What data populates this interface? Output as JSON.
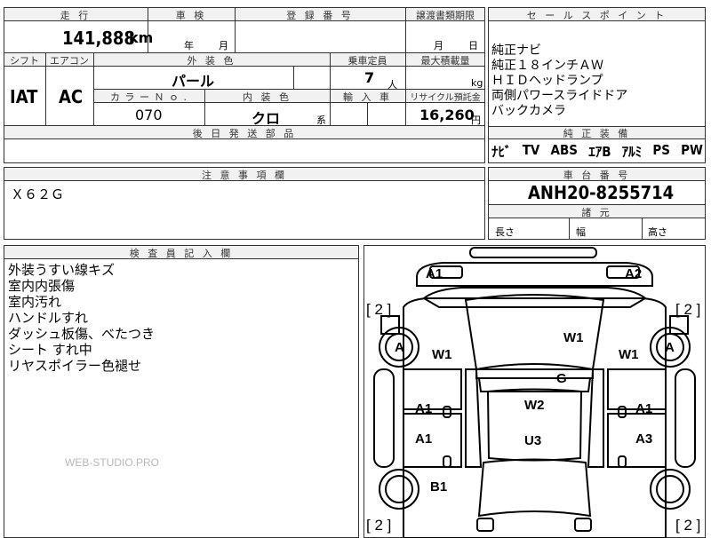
{
  "top_table": {
    "mileage_label": "走 行",
    "mileage_value": "141,888",
    "mileage_unit": "km",
    "shaken_label": "車 検",
    "shaken_year": "年",
    "shaken_month": "月",
    "registration_label": "登 録 番 号",
    "transfer_label": "譲渡書類期限",
    "transfer_month": "月",
    "transfer_day": "日",
    "shift_label": "シフト",
    "shift_value": "IAT",
    "ac_label": "エアコン",
    "ac_value": "AC",
    "exterior_color_label": "外 装 色",
    "exterior_color_value": "パール",
    "capacity_label": "乗車定員",
    "capacity_value": "7",
    "capacity_unit": "人",
    "max_load_label": "最大積載量",
    "max_load_unit": "kg",
    "color_no_label": "カ ラ ー Ｎ ｏ .",
    "color_no_value": "070",
    "interior_color_label": "内 装 色",
    "interior_color_value": "クロ",
    "interior_color_suffix": "系",
    "import_label": "輸 入 車",
    "recycle_label": "リサイクル預託金",
    "recycle_value": "16,260",
    "recycle_unit": "円",
    "later_parts_label": "後 日 発 送 部 品"
  },
  "sales_points": {
    "label": "セ ー ル ス ポ イ ン ト",
    "lines": [
      "純正ナビ",
      "純正１８インチＡＷ",
      "ＨＩＤヘッドランプ",
      "両側パワースライドドア",
      "バックカメラ"
    ]
  },
  "genuine_equipment": {
    "label": "純 正 装 備",
    "items": [
      "ﾅﾋﾞ",
      "TV",
      "ABS",
      "ｴｱB",
      "ｱﾙﾐ",
      "PS",
      "PW"
    ]
  },
  "caution": {
    "label": "注 意 事 項 欄",
    "text": "Ｘ６２Ｇ"
  },
  "chassis": {
    "label": "車 台 番 号",
    "value": "ANH20-8255714",
    "dimensions_label": "諸 元",
    "length_label": "長さ",
    "width_label": "幅",
    "height_label": "高さ"
  },
  "inspector": {
    "label": "検 査 員 記 入 欄",
    "lines": [
      "外装うすい線キズ",
      "室内内張傷",
      "室内汚れ",
      "ハンドルすれ",
      "ダッシュ板傷、べたつき",
      "シート すれ中",
      "リヤスポイラー色褪せ"
    ]
  },
  "watermark": "WEB-STUDIO.PRO",
  "damage_map": {
    "marks": {
      "a1_front_left": "A1",
      "a2_front_right": "A2",
      "a_left_wheel": "A",
      "a_right_wheel": "A",
      "w1_left": "W1",
      "w1_right": "W1",
      "w1_windshield": "W1",
      "g_roof": "G",
      "w2_roof": "W2",
      "a1_left_door_front": "A1",
      "a1_right_door_front": "A1",
      "a1_left_door_rear": "A1",
      "a3_right_door_rear": "A3",
      "u3_rear": "U3",
      "b1_left_rear": "B1"
    },
    "brackets": {
      "left_upper": "[ 2 ]",
      "right_upper": "[ 2 ]",
      "left_lower": "[ 2 ]",
      "right_lower": "[ 2 ]"
    }
  }
}
